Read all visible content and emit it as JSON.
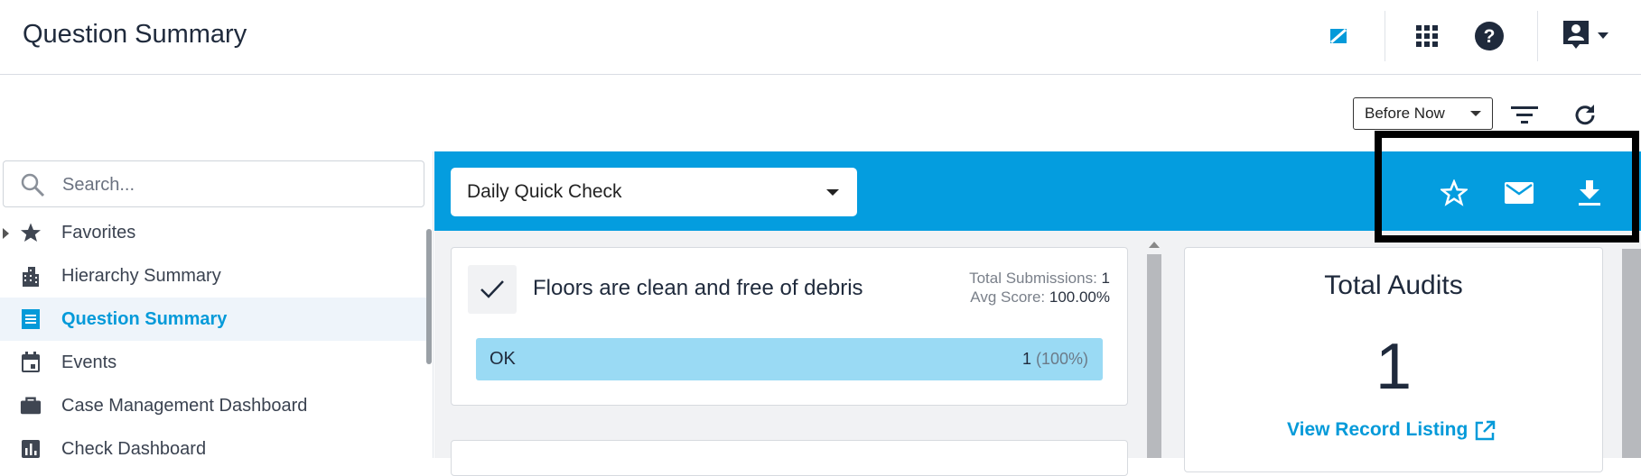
{
  "header": {
    "title": "Question Summary",
    "icons": [
      "brand-logo-icon",
      "apps-grid-icon",
      "help-icon",
      "account-icon",
      "chevron-down-icon"
    ]
  },
  "filters": {
    "range_value": "Before Now",
    "icons": [
      "filter-icon",
      "refresh-icon"
    ]
  },
  "search": {
    "placeholder": "Search..."
  },
  "sidebar": {
    "items": [
      {
        "label": "Favorites",
        "icon": "star-icon"
      },
      {
        "label": "Hierarchy Summary",
        "icon": "building-icon"
      },
      {
        "label": "Question Summary",
        "icon": "list-icon"
      },
      {
        "label": "Events",
        "icon": "calendar-icon"
      },
      {
        "label": "Case Management Dashboard",
        "icon": "briefcase-icon"
      },
      {
        "label": "Check Dashboard",
        "icon": "bar-chart-icon"
      }
    ],
    "active_index": 2
  },
  "toolbar": {
    "survey_value": "Daily Quick Check",
    "actions": [
      "favorite-star-icon",
      "email-icon",
      "download-icon"
    ]
  },
  "question_card": {
    "title": "Floors are clean and free of debris",
    "submissions_label": "Total Submissions:",
    "submissions_value": "1",
    "avg_label": "Avg Score:",
    "avg_value": "100.00%",
    "answer": {
      "label": "OK",
      "count": "1",
      "percent": "(100%)"
    }
  },
  "audits_card": {
    "title": "Total Audits",
    "value": "1",
    "link_label": "View Record Listing"
  },
  "colors": {
    "accent": "#049ddf",
    "answer_bar": "#9adaf4",
    "text": "#1f2a3c"
  }
}
